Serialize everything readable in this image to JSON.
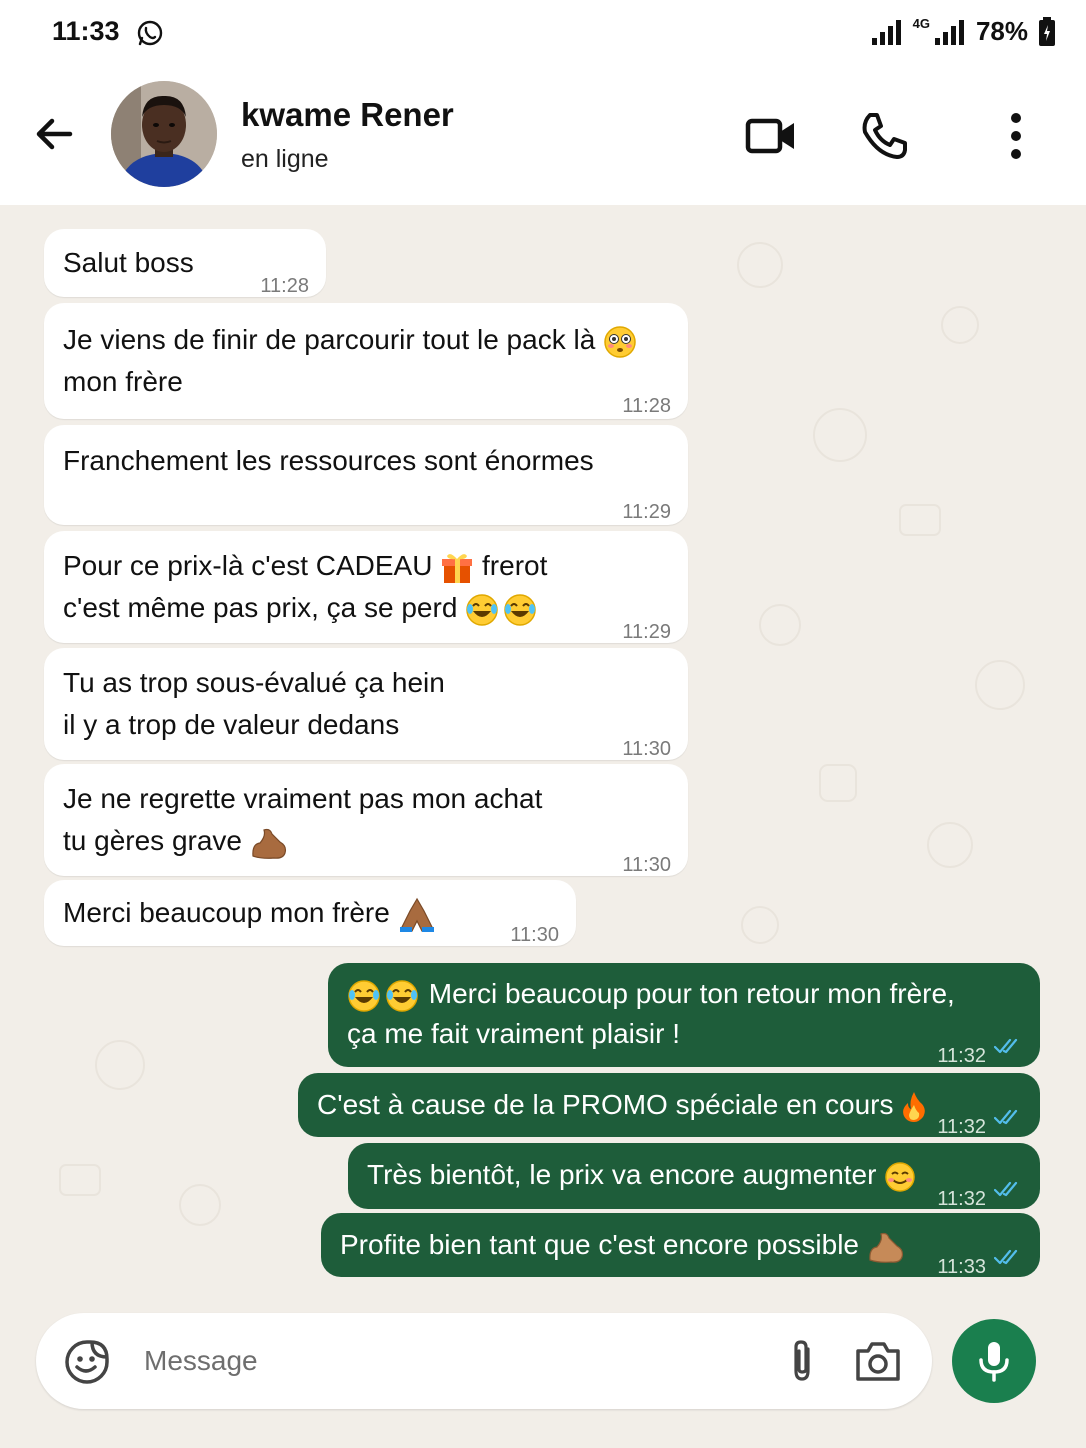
{
  "status_bar": {
    "time": "11:33",
    "network": "4G",
    "battery": "78%"
  },
  "header": {
    "contact_name": "kwame Rener",
    "contact_status": "en ligne"
  },
  "messages": [
    {
      "dir": "in",
      "text": "Salut boss",
      "time": "11:28"
    },
    {
      "dir": "in",
      "line1": "Je viens de finir de parcourir tout le pack là",
      "line2": "mon frère",
      "time": "11:28"
    },
    {
      "dir": "in",
      "text": "Franchement les ressources sont énormes",
      "time": "11:29"
    },
    {
      "dir": "in",
      "line1a": "Pour ce prix-là c'est CADEAU",
      "line1b": "frerot",
      "line2": "c'est même pas prix, ça se perd",
      "time": "11:29"
    },
    {
      "dir": "in",
      "line1": "Tu as trop sous-évalué ça hein",
      "line2": "il y a trop de valeur dedans",
      "time": "11:30"
    },
    {
      "dir": "in",
      "line1": "Je ne regrette vraiment pas mon achat",
      "line2": "tu gères grave",
      "time": "11:30"
    },
    {
      "dir": "in",
      "text": "Merci beaucoup mon frère",
      "time": "11:30"
    },
    {
      "dir": "out",
      "line1": "Merci beaucoup pour ton retour mon frère,",
      "line2": "ça me fait vraiment plaisir !",
      "time": "11:32"
    },
    {
      "dir": "out",
      "text": "C'est à cause de la PROMO spéciale en cours",
      "time": "11:32"
    },
    {
      "dir": "out",
      "text": "Très bientôt, le prix va encore augmenter",
      "time": "11:32"
    },
    {
      "dir": "out",
      "text": "Profite bien tant que c'est encore possible",
      "time": "11:33"
    }
  ],
  "input": {
    "placeholder": "Message"
  },
  "icons": {
    "back": "arrow-left-icon",
    "video": "video-camera-icon",
    "call": "phone-icon",
    "menu": "more-vertical-icon",
    "sticker": "sticker-icon",
    "attach": "paperclip-icon",
    "camera": "camera-icon",
    "mic": "microphone-icon"
  },
  "colors": {
    "outgoing_bubble": "#1e5d3a",
    "incoming_bubble": "#ffffff",
    "chat_background": "#f2eee8",
    "mic_button": "#1a7f4e",
    "read_ticks": "#53bdeb"
  }
}
